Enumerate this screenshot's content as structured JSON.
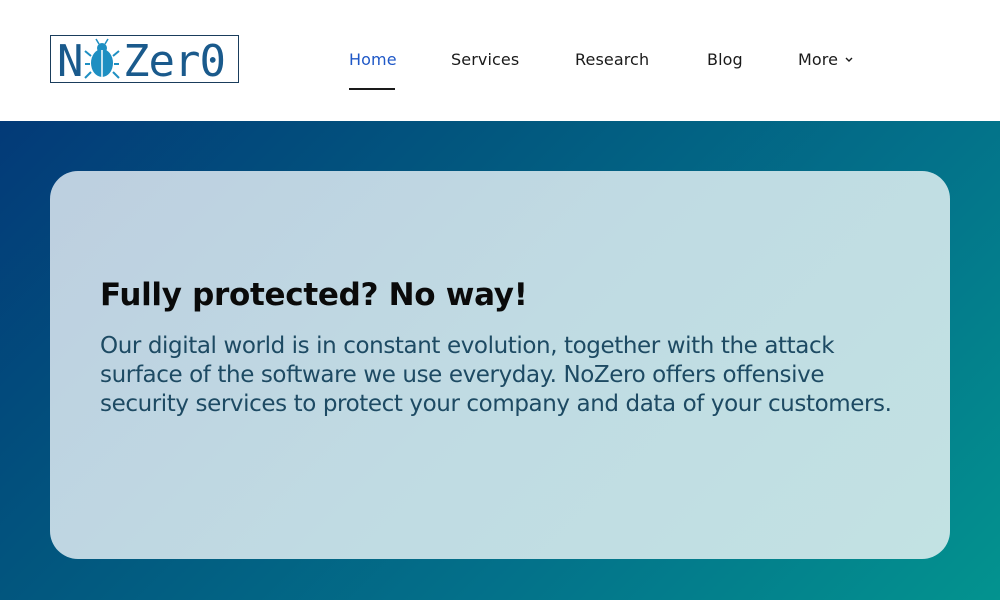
{
  "logo": {
    "text": "NoZer0",
    "colors": {
      "text": "#1a5a8c",
      "bug": "#1e8fc2",
      "border": "#1a3d5c"
    },
    "icon": "bug-icon"
  },
  "nav": {
    "items": [
      {
        "label": "Home",
        "active": true
      },
      {
        "label": "Services",
        "active": false
      },
      {
        "label": "Research",
        "active": false
      },
      {
        "label": "Blog",
        "active": false
      },
      {
        "label": "More",
        "active": false,
        "icon": "chevron-down-icon"
      }
    ]
  },
  "hero": {
    "title": "Fully protected? No way!",
    "text": "Our digital world is in constant evolution, together with the attack surface of the software we use everyday. NoZero offers offensive security services to protect your company and data of your customers."
  },
  "colors": {
    "accent": "#1f58c7",
    "hero_gradient_start": "#033a78",
    "hero_gradient_end": "#03938f",
    "card_bg": "#c0dbe3",
    "card_text": "#1d4a63"
  }
}
